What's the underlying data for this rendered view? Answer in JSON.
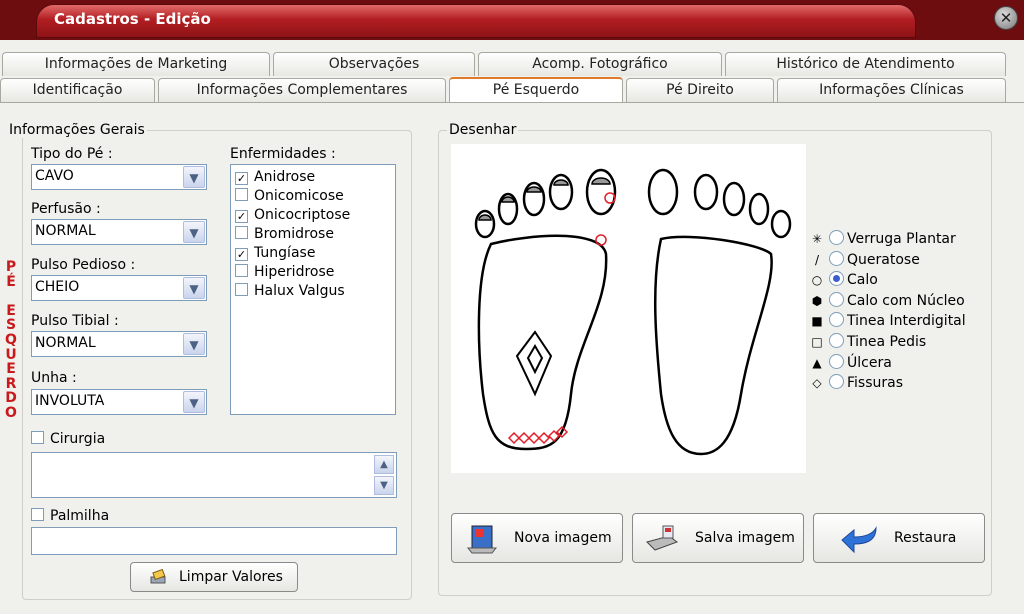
{
  "window": {
    "title": "Cadastros - Edição",
    "close_symbol": "✕"
  },
  "tabs_row1": [
    "Informações de Marketing",
    "Observações",
    "Acomp. Fotográfico",
    "Histórico de Atendimento"
  ],
  "tabs_row2": [
    "Identificação",
    "Informações Complementares",
    "Pé Esquerdo",
    "Pé Direito",
    "Informações Clínicas"
  ],
  "active_tab": "Pé Esquerdo",
  "side_label": [
    "P",
    "É",
    "",
    "E",
    "S",
    "Q",
    "U",
    "E",
    "R",
    "D",
    "O"
  ],
  "info_gerais": {
    "title": "Informações Gerais",
    "tipo_label": "Tipo do Pé :",
    "tipo_value": "CAVO",
    "perfusao_label": "Perfusão :",
    "perfusao_value": "NORMAL",
    "pulso_pedioso_label": "Pulso Pedioso :",
    "pulso_pedioso_value": "CHEIO",
    "pulso_tibial_label": "Pulso Tibial :",
    "pulso_tibial_value": "NORMAL",
    "unha_label": "Unha :",
    "unha_value": "INVOLUTA",
    "cirurgia_label": "Cirurgia",
    "palmilha_label": "Palmilha",
    "limpar_label": "Limpar Valores"
  },
  "enfermidades": {
    "title": "Enfermidades :",
    "items": [
      {
        "label": "Anidrose",
        "checked": true
      },
      {
        "label": "Onicomicose",
        "checked": false
      },
      {
        "label": "Onicocriptose",
        "checked": true
      },
      {
        "label": "Bromidrose",
        "checked": false
      },
      {
        "label": "Tungíase",
        "checked": true
      },
      {
        "label": "Hiperidrose",
        "checked": false
      },
      {
        "label": "Halux Valgus",
        "checked": false
      }
    ]
  },
  "desenhar": {
    "title": "Desenhar",
    "legend": [
      {
        "symbol": "✳",
        "label": "Verruga Plantar",
        "selected": false
      },
      {
        "symbol": "/",
        "label": "Queratose",
        "selected": false
      },
      {
        "symbol": "○",
        "label": "Calo",
        "selected": true
      },
      {
        "symbol": "⬢",
        "label": "Calo com Núcleo",
        "selected": false
      },
      {
        "symbol": "■",
        "label": "Tinea Interdigital",
        "selected": false
      },
      {
        "symbol": "□",
        "label": "Tinea Pedis",
        "selected": false
      },
      {
        "symbol": "▲",
        "label": "Úlcera",
        "selected": false
      },
      {
        "symbol": "◇",
        "label": "Fissuras",
        "selected": false
      }
    ],
    "nova_label": "Nova imagem",
    "salva_label": "Salva imagem",
    "restaura_label": "Restaura"
  },
  "colors": {
    "accent_red": "#c8191d",
    "marker_red": "#e0202a",
    "tab_active": "#e0792a"
  }
}
